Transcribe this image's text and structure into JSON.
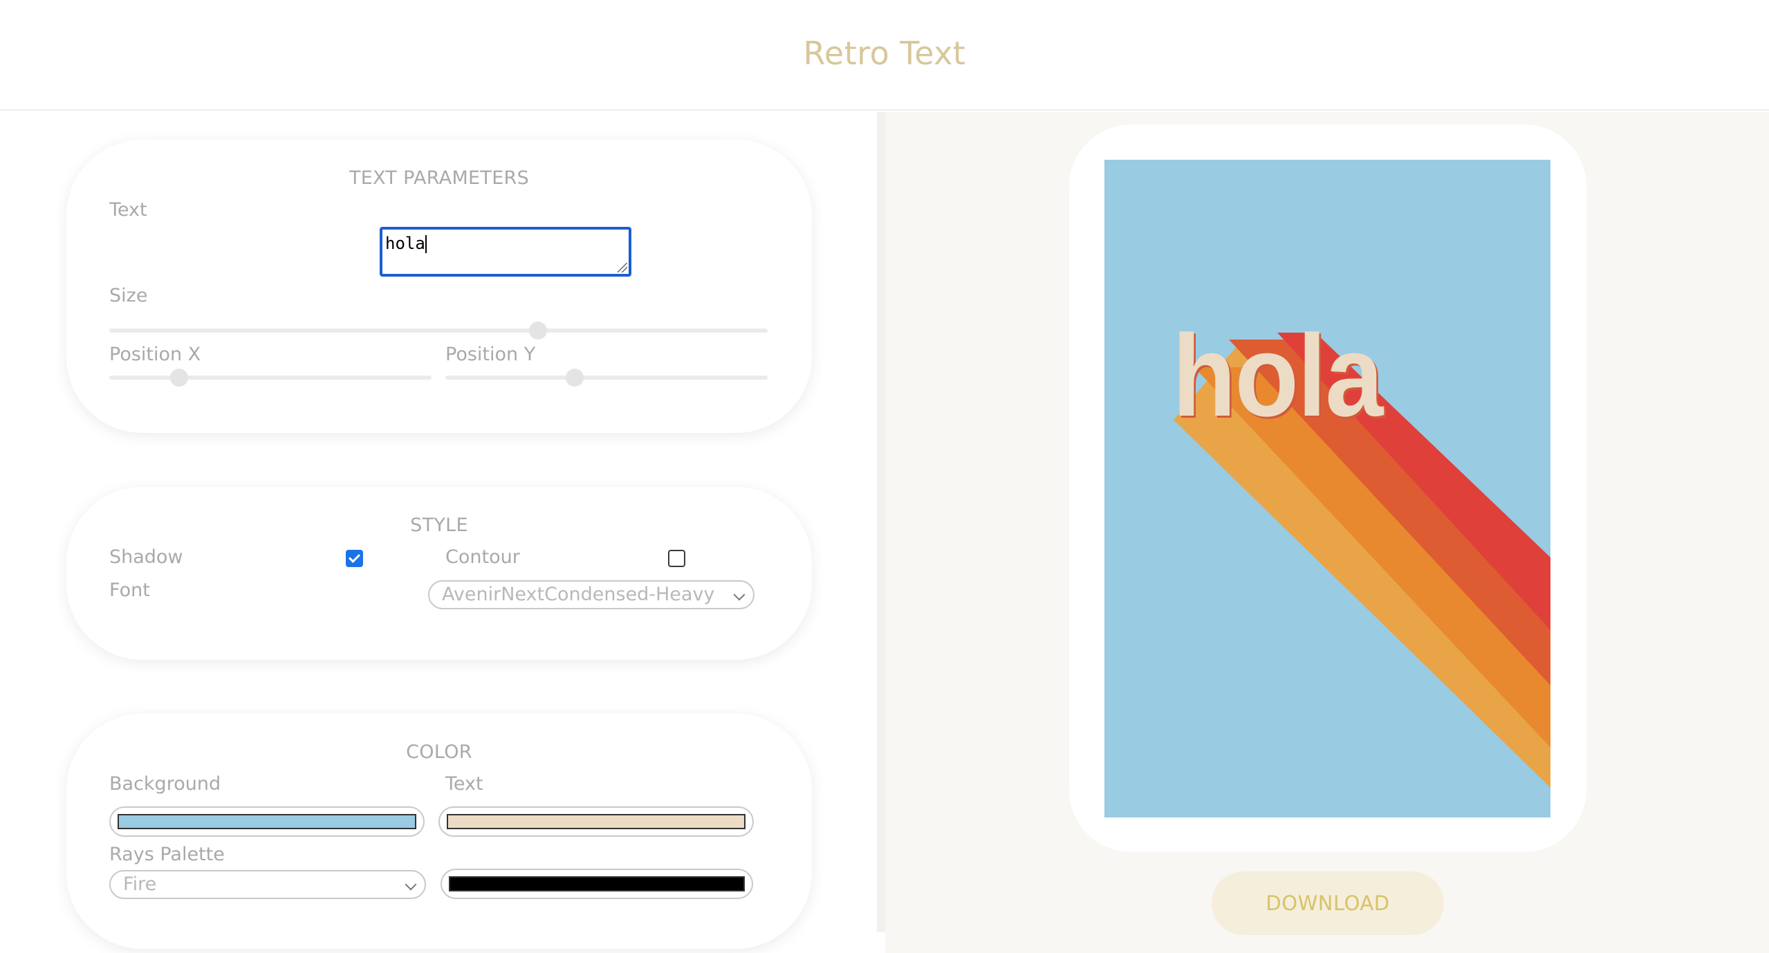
{
  "header": {
    "title": "Retro Text"
  },
  "text_parameters": {
    "title": "TEXT PARAMETERS",
    "text_label": "Text",
    "text_value": "hola",
    "size_label": "Size",
    "size_value": 0.65,
    "position_x_label": "Position X",
    "position_x_value": 0.21,
    "position_y_label": "Position Y",
    "position_y_value": 0.4
  },
  "style": {
    "title": "STYLE",
    "shadow_label": "Shadow",
    "shadow_checked": true,
    "contour_label": "Contour",
    "contour_checked": false,
    "font_label": "Font",
    "font_value": "AvenirNextCondensed-Heavy"
  },
  "color": {
    "title": "COLOR",
    "background_label": "Background",
    "background_color": "#99cbe3",
    "text_label": "Text",
    "text_color": "#ecdcc5",
    "rays_palette_label": "Rays Palette",
    "rays_palette_value": "Fire",
    "contour_color": "#000000"
  },
  "preview": {
    "text": "hola",
    "background_color": "#99cbe3",
    "text_color": "#ecdcc5",
    "ray_colors": [
      "#e9a448",
      "#e8892f",
      "#de5c31",
      "#e0403a"
    ]
  },
  "download": {
    "label": "DOWNLOAD"
  }
}
